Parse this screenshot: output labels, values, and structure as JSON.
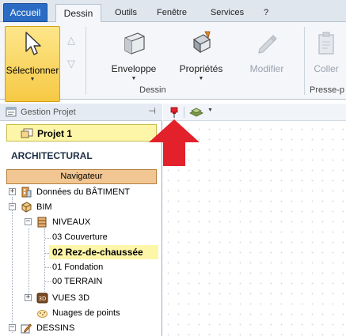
{
  "menu": {
    "tabs": [
      "Accueil",
      "Dessin",
      "Outils",
      "Fenêtre",
      "Services",
      "?"
    ],
    "active_tab": "Dessin"
  },
  "ribbon": {
    "select_label": "Sélectionner",
    "buttons": [
      {
        "label": "Enveloppe",
        "icon": "envelope-wall-icon"
      },
      {
        "label": "Propriétés",
        "icon": "properties-paint-icon"
      },
      {
        "label": "Modifier",
        "icon": "modify-icon",
        "disabled": true
      },
      {
        "label": "Coller",
        "icon": "paste-icon",
        "disabled": true
      }
    ],
    "group_dessin": "Dessin",
    "group_presse": "Presse-p"
  },
  "panel": {
    "title": "Gestion Projet",
    "project": "Projet 1",
    "section": "ARCHITECTURAL",
    "navigator": "Navigateur",
    "tree": [
      {
        "label": "Données du BÂTIMENT",
        "toggle": "+",
        "icon": "building-data-icon"
      },
      {
        "label": "BIM",
        "toggle": "−",
        "icon": "bim-cube-icon"
      },
      {
        "label": "NIVEAUX",
        "toggle": "−",
        "icon": "levels-icon"
      },
      {
        "label": "03 Couverture"
      },
      {
        "label": "02 Rez-de-chaussée",
        "selected": true
      },
      {
        "label": "01 Fondation"
      },
      {
        "label": "00 TERRAIN"
      },
      {
        "label": "VUES 3D",
        "toggle": "+",
        "icon": "3d-views-icon"
      },
      {
        "label": "Nuages de points",
        "icon": "point-cloud-icon"
      },
      {
        "label": "DESSINS",
        "toggle": "−",
        "icon": "drawings-icon"
      }
    ]
  },
  "colors": {
    "accent_blue": "#2a6bc4",
    "selection_yellow": "#fdf6a8",
    "navigator_orange": "#f2c692",
    "callout_red": "#e3212b"
  }
}
